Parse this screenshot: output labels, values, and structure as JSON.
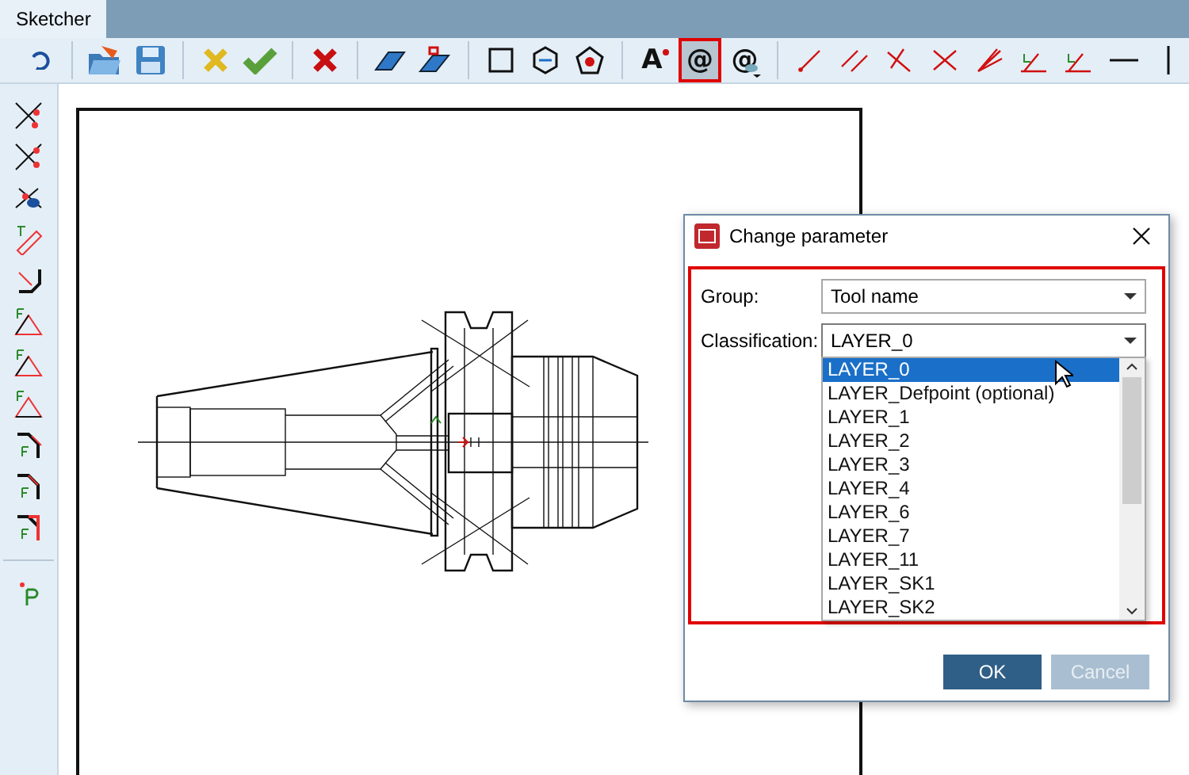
{
  "tab": {
    "label": "Sketcher",
    "selected": true
  },
  "toolbar": {
    "text_buttons": [
      {
        "label": "A",
        "selected": false
      },
      {
        "label": "@",
        "selected": true
      },
      {
        "label": "@",
        "selected": false
      }
    ]
  },
  "dialog": {
    "title": "Change parameter",
    "fields": [
      {
        "label": "Group:",
        "value": "Tool name",
        "expanded": false
      },
      {
        "label": "Classification:",
        "value": "LAYER_0",
        "expanded": true
      }
    ],
    "options": [
      {
        "label": "LAYER_0",
        "selected": true
      },
      {
        "label": "LAYER_Defpoint (optional)",
        "selected": false
      },
      {
        "label": "LAYER_1",
        "selected": false
      },
      {
        "label": "LAYER_2",
        "selected": false
      },
      {
        "label": "LAYER_3",
        "selected": false
      },
      {
        "label": "LAYER_4",
        "selected": false
      },
      {
        "label": "LAYER_6",
        "selected": false
      },
      {
        "label": "LAYER_7",
        "selected": false
      },
      {
        "label": "LAYER_11",
        "selected": false
      },
      {
        "label": "LAYER_SK1",
        "selected": false
      },
      {
        "label": "LAYER_SK2",
        "selected": false
      }
    ],
    "buttons": [
      {
        "label": "OK",
        "disabled": false
      },
      {
        "label": "Cancel",
        "disabled": true
      }
    ]
  }
}
